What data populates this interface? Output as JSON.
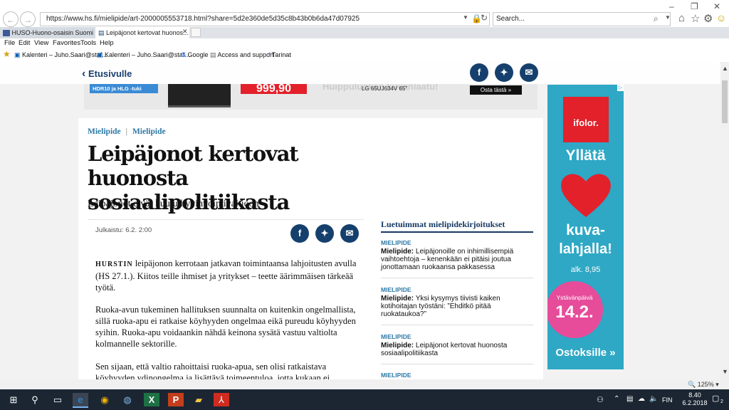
{
  "browser": {
    "url": "https://www.hs.fi/mielipide/art-2000005553718.html?share=5d2e360de5d35c8b43b0b6da47d07925",
    "search_placeholder": "Search...",
    "tabs": [
      {
        "label": "HUSO-Huono-osaisin Suomi -..."
      },
      {
        "label": "Leipäjonot kertovat huonos..."
      }
    ],
    "menu": [
      "File",
      "Edit",
      "View",
      "Favorites",
      "Tools",
      "Help"
    ],
    "favorites": [
      "Kalenteri – Juho.Saari@staf...",
      "Kalenteri – Juho.Saari@staf...",
      "Google",
      "Access and support",
      "Tarinat"
    ],
    "zoom": "125%"
  },
  "page": {
    "back_label": "Etusivulle",
    "ad_banner": {
      "badge": "HDR10 ja HLG -tuki",
      "price": "999,90",
      "headline": "Huippuluokan kuvanlaatu!",
      "model": "LG 65UJ634V 65\"",
      "cta": "Osta tästä »"
    },
    "article": {
      "section_a": "Mielipide",
      "section_sep": "|",
      "section_b": "Mielipide",
      "headline": "Leipäjonot kertovat huonosta sosiaalipolitiikasta",
      "lead": "Leipäjonot eivät kuulu hyvinvointivaltioon",
      "published": "Julkaistu: 6.2. 2:00",
      "p1_lead": "HURSTIN",
      "p1": "leipäjonon kerrotaan jatkavan toimintaansa lahjoitusten avulla (HS 27.1.). Kiitos teille ihmiset ja yritykset – teette äärimmäisen tärkeää työtä.",
      "p2": "Ruoka-avun tukeminen hallituksen suunnalta on kuitenkin ongelmallista, sillä ruoka-apu ei ratkaise köyhyyden ongelmaa eikä pureudu köyhyyden syihin. Ruoka-apu voidaankin nähdä keinona sysätä vastuu valtiolta kolmannelle sektorille.",
      "p3": "Sen sijaan, että valtio rahoittaisi ruoka-apua, sen olisi ratkaistava köyhyyden ydinongelma ja lisättävä toimeentuloa, jotta kukaan ei"
    },
    "sidebar": {
      "title": "Luetuimmat mielipidekirjoitukset",
      "items": [
        {
          "tag": "MIELIPIDE",
          "prefix": "Mielipide:",
          "text": "Leipäjonoille on inhimillisempiä vaihtoehtoja – kenenkään ei pitäisi joutua jonottamaan ruokaansa pakkasessa"
        },
        {
          "tag": "MIELIPIDE",
          "prefix": "Mielipide:",
          "text": "Yksi kysymys tiivisti kaiken kotihoitajan työstäni: ”Ehditkö pitää ruokataukoa?”"
        },
        {
          "tag": "MIELIPIDE",
          "prefix": "Mielipide:",
          "text": "Leipäjonot kertovat huonosta sosiaalipolitiikasta"
        },
        {
          "tag": "MIELIPIDE"
        }
      ]
    },
    "right_ad": {
      "brand": "ifolor.",
      "line1": "Yllätä",
      "line2": "kuva-",
      "line3": "lahjalla!",
      "price": "alk. 8,95",
      "badge_top": "Ystävänpäivä",
      "badge_date": "14.2.",
      "cta": "Ostoksille »"
    }
  },
  "taskbar": {
    "lang": "FIN",
    "time": "8.40",
    "date": "6.2.2018",
    "notifications": "2"
  },
  "colors": {
    "navy": "#15406d",
    "link_blue": "#2d79a6",
    "ad_teal": "#2ea8c5",
    "ad_red": "#e2212b"
  }
}
